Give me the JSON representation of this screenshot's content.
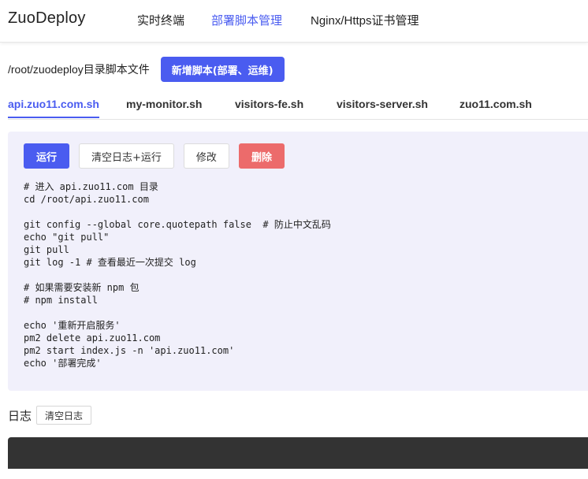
{
  "app": {
    "title": "ZuoDeploy"
  },
  "nav": {
    "items": [
      {
        "label": "实时终端",
        "active": false
      },
      {
        "label": "部署脚本管理",
        "active": true
      },
      {
        "label": "Nginx/Https证书管理",
        "active": false
      }
    ]
  },
  "toolbar": {
    "dir_label": "/root/zuodeploy目录脚本文件",
    "new_script_label": "新增脚本(部署、运维)"
  },
  "tabs": [
    {
      "label": "api.zuo11.com.sh",
      "active": true
    },
    {
      "label": "my-monitor.sh",
      "active": false
    },
    {
      "label": "visitors-fe.sh",
      "active": false
    },
    {
      "label": "visitors-server.sh",
      "active": false
    },
    {
      "label": "zuo11.com.sh",
      "active": false
    }
  ],
  "actions": {
    "run_label": "运行",
    "clear_run_label": "清空日志+运行",
    "edit_label": "修改",
    "delete_label": "删除"
  },
  "script": {
    "content": "# 进入 api.zuo11.com 目录\ncd /root/api.zuo11.com\n\ngit config --global core.quotepath false  # 防止中文乱码\necho \"git pull\"\ngit pull\ngit log -1 # 查看最近一次提交 log\n\n# 如果需要安装新 npm 包\n# npm install\n\necho '重新开启服务'\npm2 delete api.zuo11.com\npm2 start index.js -n 'api.zuo11.com'\necho '部署完成'"
  },
  "log": {
    "title": "日志",
    "clear_label": "清空日志"
  },
  "colors": {
    "accent": "#4a5cf0",
    "danger": "#ec6b6b",
    "panel_bg": "#f1f0fb",
    "console_bg": "#333333"
  }
}
